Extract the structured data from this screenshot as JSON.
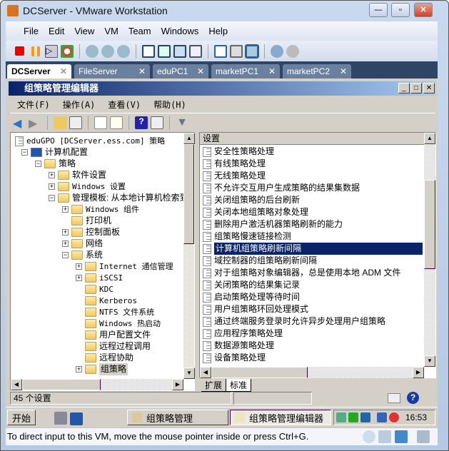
{
  "window": {
    "title": "DCServer - VMware Workstation"
  },
  "menu": [
    "File",
    "Edit",
    "View",
    "VM",
    "Team",
    "Windows",
    "Help"
  ],
  "tabs": [
    {
      "label": "DCServer",
      "active": true
    },
    {
      "label": "FileServer"
    },
    {
      "label": "eduPC1"
    },
    {
      "label": "marketPC1"
    },
    {
      "label": "marketPC2"
    }
  ],
  "inner": {
    "title": "组策略管理编辑器",
    "menu": [
      "文件(F)",
      "操作(A)",
      "查看(V)",
      "帮助(H)"
    ]
  },
  "tree": [
    {
      "label": "eduGPO [DCServer.ess.com] 策略",
      "level": 0,
      "exp": "",
      "icon": "doc"
    },
    {
      "label": "计算机配置",
      "level": 1,
      "exp": "-",
      "icon": "computer"
    },
    {
      "label": "策略",
      "level": 2,
      "exp": "-",
      "icon": "folder"
    },
    {
      "label": "软件设置",
      "level": 3,
      "exp": "+",
      "icon": "folder"
    },
    {
      "label": "Windows 设置",
      "level": 3,
      "exp": "+",
      "icon": "folder"
    },
    {
      "label": "管理模板: 从本地计算机检索到的策略定义",
      "level": 3,
      "exp": "-",
      "icon": "folder"
    },
    {
      "label": "Windows 组件",
      "level": 4,
      "exp": "+",
      "icon": "folder"
    },
    {
      "label": "打印机",
      "level": 4,
      "exp": "",
      "icon": "folder"
    },
    {
      "label": "控制面板",
      "level": 4,
      "exp": "+",
      "icon": "folder"
    },
    {
      "label": "网络",
      "level": 4,
      "exp": "+",
      "icon": "folder"
    },
    {
      "label": "系统",
      "level": 4,
      "exp": "-",
      "icon": "folder"
    },
    {
      "label": "Internet 通信管理",
      "level": 5,
      "exp": "+",
      "icon": "folder"
    },
    {
      "label": "iSCSI",
      "level": 5,
      "exp": "+",
      "icon": "folder"
    },
    {
      "label": "KDC",
      "level": 5,
      "exp": "",
      "icon": "folder"
    },
    {
      "label": "Kerberos",
      "level": 5,
      "exp": "",
      "icon": "folder"
    },
    {
      "label": "NTFS 文件系统",
      "level": 5,
      "exp": "",
      "icon": "folder"
    },
    {
      "label": "Windows 热启动",
      "level": 5,
      "exp": "",
      "icon": "folder"
    },
    {
      "label": "用户配置文件",
      "level": 5,
      "exp": "",
      "icon": "folder"
    },
    {
      "label": "远程过程调用",
      "level": 5,
      "exp": "",
      "icon": "folder"
    },
    {
      "label": "远程协助",
      "level": 5,
      "exp": "",
      "icon": "folder"
    },
    {
      "label": "组策略",
      "level": 5,
      "exp": "+",
      "icon": "folder",
      "selected": true
    }
  ],
  "list": {
    "header": "设置",
    "selected_index": 8,
    "items": [
      "安全性策略处理",
      "有线策略处理",
      "无线策略处理",
      "不允许交互用户生成策略的结果集数据",
      "关闭组策略的后台刷新",
      "关闭本地组策略对象处理",
      "删除用户激活机器策略刷新的能力",
      "组策略慢速链接检测",
      "计算机组策略刷新间隔",
      "域控制器的组策略刷新间隔",
      "对于组策略对象编辑器，总是使用本地 ADM 文件",
      "关闭策略的结果集记录",
      "启动策略处理等待时间",
      "用户组策略环回处理模式",
      "通过终端服务登录时允许异步处理用户组策略",
      "应用程序策略处理",
      "数据源策略处理",
      "设备策略处理"
    ]
  },
  "view_tabs": [
    "扩展",
    "标准"
  ],
  "status": "45 个设置",
  "taskbar": {
    "start": "开始",
    "buttons": [
      "组策略管理",
      "组策略管理编辑器"
    ],
    "clock": "16:53"
  },
  "vmstatus": "To direct input to this VM, move the mouse pointer inside or press Ctrl+G.",
  "colors": {
    "selection": "#0a246a",
    "tabstrip": "#2f4565"
  }
}
